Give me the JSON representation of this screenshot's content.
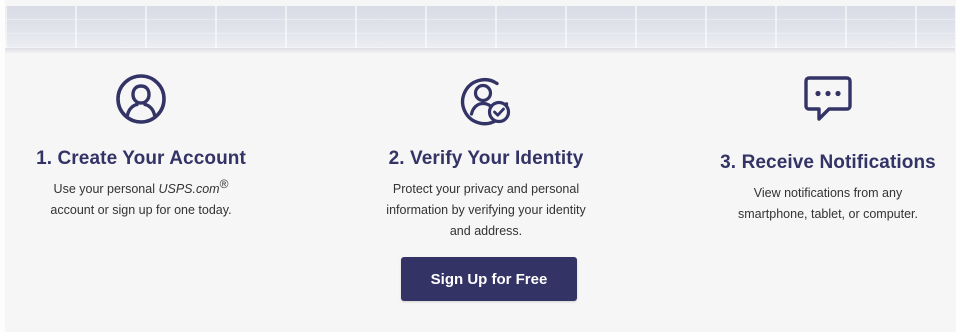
{
  "steps": [
    {
      "title": "1. Create Your Account",
      "desc_before": "Use your personal ",
      "brand": "USPS.com",
      "reg_mark": "®",
      "desc_after": "account or sign up for one today.",
      "icon": "user-circle-icon"
    },
    {
      "title": "2. Verify Your Identity",
      "desc_line1": "Protect your privacy and personal",
      "desc_line2": "information by verifying your identity",
      "desc_line3": "and address.",
      "icon": "verified-user-icon"
    },
    {
      "title": "3. Receive Notifications",
      "desc_line1": "View notifications from any",
      "desc_line2": "smartphone, tablet, or computer.",
      "icon": "chat-bubble-icon"
    }
  ],
  "cta": {
    "label": "Sign Up for Free"
  },
  "colors": {
    "brand_navy": "#333366",
    "background": "#f6f6f6",
    "text": "#333333"
  }
}
